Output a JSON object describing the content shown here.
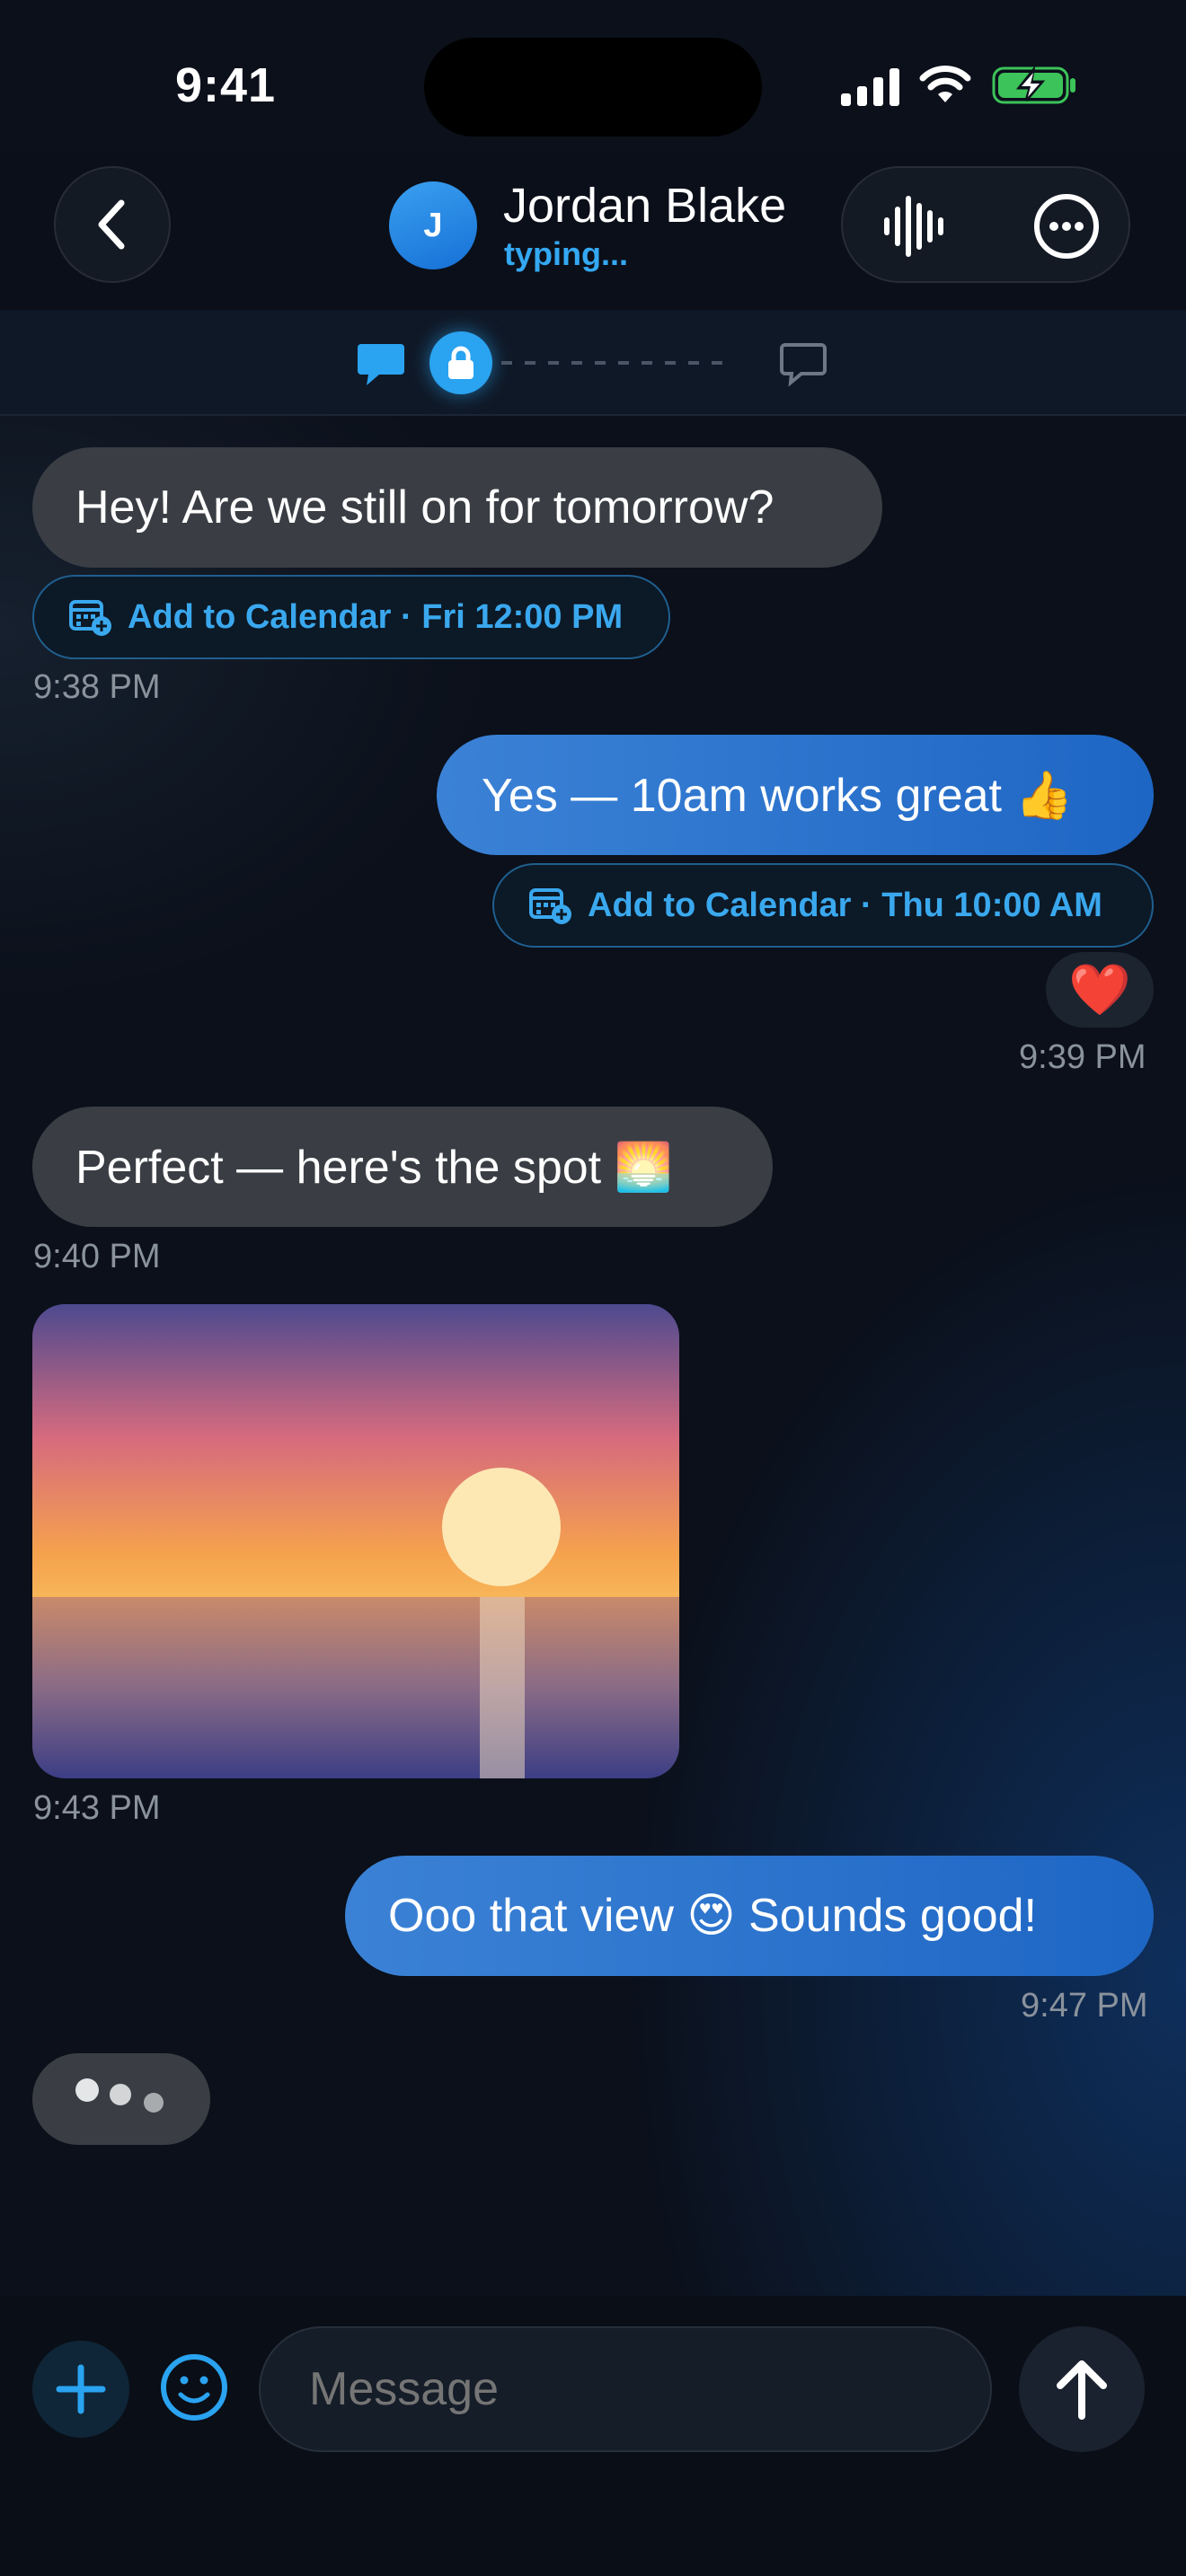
{
  "status_bar": {
    "time": "9:41"
  },
  "header": {
    "avatar_initial": "J",
    "contact_name": "Jordan Blake",
    "contact_status": "typing..."
  },
  "messages": [
    {
      "direction": "incoming",
      "text": "Hey! Are we still on for tomorrow?",
      "calendar": "Add to Calendar · Fri 12:00 PM",
      "time": "9:38 PM"
    },
    {
      "direction": "outgoing",
      "text": "Yes — 10am works great 👍",
      "calendar": "Add to Calendar · Thu 10:00 AM",
      "reaction": "❤️",
      "time": "9:39 PM"
    },
    {
      "direction": "incoming",
      "text": "Perfect — here's the spot 🌅",
      "time": "9:40 PM"
    },
    {
      "direction": "incoming",
      "type": "photo",
      "time": "9:43 PM"
    },
    {
      "direction": "outgoing",
      "text": "Ooo that view 😍 Sounds good!",
      "time": "9:47 PM"
    }
  ],
  "composer": {
    "placeholder": "Message"
  },
  "colors": {
    "accent": "#34a8f2",
    "outgoing_bubble": "#2f78d2",
    "incoming_bubble": "#3a3e44",
    "battery": "#3cc35a"
  },
  "icons": [
    "back-chevron-icon",
    "waveform-icon",
    "more-icon",
    "chat-bubble-icon",
    "lock-icon",
    "chat-outline-icon",
    "calendar-add-icon",
    "plus-icon",
    "smiley-icon",
    "arrow-up-icon"
  ]
}
